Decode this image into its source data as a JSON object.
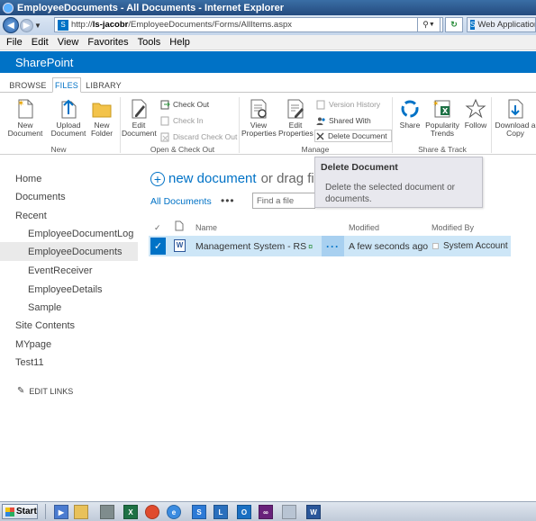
{
  "window": {
    "title": "EmployeeDocuments - All Documents - Internet Explorer"
  },
  "address": {
    "url_prefix": "http://",
    "url_host": "ls-jacobr",
    "url_path": "/EmployeeDocuments/Forms/AllItems.aspx",
    "tab_label": "Web Applications"
  },
  "menubar": [
    "File",
    "Edit",
    "View",
    "Favorites",
    "Tools",
    "Help"
  ],
  "suite": {
    "brand": "SharePoint"
  },
  "ribbon_tabs": [
    "BROWSE",
    "FILES",
    "LIBRARY"
  ],
  "ribbon": {
    "new_document": "New Document",
    "upload_document": "Upload Document",
    "new_folder": "New Folder",
    "edit_document": "Edit Document",
    "check_out": "Check Out",
    "check_in": "Check In",
    "discard_check_out": "Discard Check Out",
    "view_properties": "View Properties",
    "edit_properties": "Edit Properties",
    "version_history": "Version History",
    "shared_with": "Shared With",
    "delete_document": "Delete Document",
    "share": "Share",
    "popularity_trends": "Popularity Trends",
    "follow": "Follow",
    "download_copy": "Download a Copy",
    "groups": {
      "new": "New",
      "open_check_out": "Open & Check Out",
      "manage": "Manage",
      "share_track": "Share & Track"
    }
  },
  "tooltip": {
    "title": "Delete Document",
    "description": "Delete the selected document or documents."
  },
  "left_nav": {
    "items": [
      {
        "label": "Home"
      },
      {
        "label": "Documents"
      },
      {
        "label": "Recent"
      },
      {
        "label": "EmployeeDocumentLog"
      },
      {
        "label": "EmployeeDocuments"
      },
      {
        "label": "EventReceiver"
      },
      {
        "label": "EmployeeDetails"
      },
      {
        "label": "Sample"
      },
      {
        "label": "Site Contents"
      },
      {
        "label": "MYpage"
      },
      {
        "label": "Test11"
      }
    ],
    "edit_links": "EDIT LINKS"
  },
  "main": {
    "new_document": "new document",
    "drag_hint": "or drag file",
    "view_name": "All Documents",
    "search_placeholder": "Find a file",
    "columns": {
      "name": "Name",
      "modified": "Modified",
      "modified_by": "Modified By"
    },
    "rows": [
      {
        "name": "Management System - RS",
        "new_marker": "¤",
        "modified": "A few seconds ago",
        "modified_by": "System Account"
      }
    ]
  },
  "taskbar": {
    "start": "Start"
  }
}
